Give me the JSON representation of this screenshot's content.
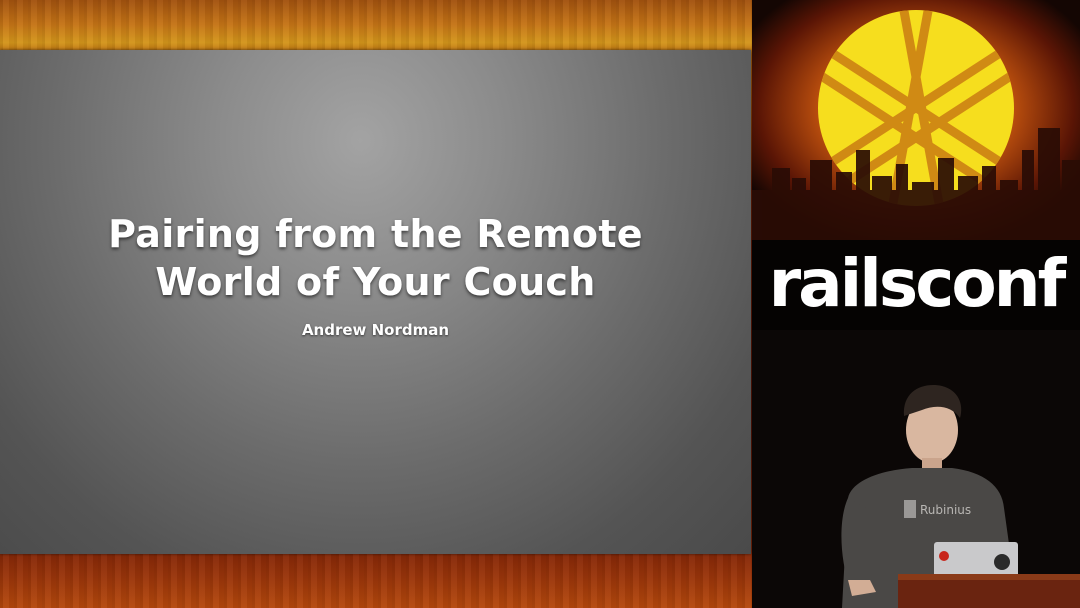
{
  "slide": {
    "title_line1": "Pairing from the Remote",
    "title_line2": "World of Your Couch",
    "author": "Andrew Nordman"
  },
  "branding": {
    "wordmark": "railsconf",
    "logo_icon": "railsconf-sun-skyline-logo"
  },
  "speaker": {
    "shirt_text": "Rubinius"
  },
  "colors": {
    "slide_gray": "#8c8c8c",
    "accent_orange": "#e8a41c",
    "logo_yellow": "#f6de1e",
    "wood_red": "#6b1f06"
  }
}
